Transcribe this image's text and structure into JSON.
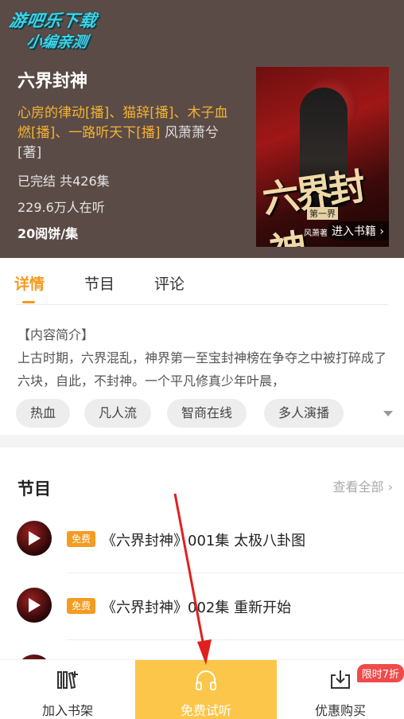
{
  "watermark": {
    "line1": "游吧乐下载",
    "line2": "小编亲测"
  },
  "book": {
    "title": "六界封神",
    "narrators": "心房的律动[播]、猫辞[播]、木子血燃[播]、一路听天下[播]",
    "author": "风萧萧兮[著]",
    "status": "已完结 共426集",
    "listeners": "229.6万人在听",
    "price": "20阅饼/集"
  },
  "cover": {
    "title_art": "六界封神",
    "volume": "第一界",
    "publisher": "风萧著",
    "enter_label": "进入书籍 ›"
  },
  "tabs": [
    {
      "label": "详情",
      "active": true
    },
    {
      "label": "节目",
      "active": false
    },
    {
      "label": "评论",
      "active": false
    }
  ],
  "intro": {
    "text": "【内容简介】\n上古时期，六界混乱，神界第一至宝封神榜在争夺之中被打碎成了六块，自此，不封神。一个平凡修真少年叶晨，"
  },
  "tags": [
    "热血",
    "凡人流",
    "智商在线",
    "多人演播"
  ],
  "episodes": {
    "heading": "节目",
    "view_all": "查看全部 ›",
    "items": [
      {
        "badge": "免费",
        "title": "《六界封神》001集 太极八卦图"
      },
      {
        "badge": "免费",
        "title": "《六界封神》002集 重新开始"
      }
    ]
  },
  "bottom_bar": {
    "shelf": "加入书架",
    "free_listen": "免费试听",
    "buy": "优惠购买",
    "limit_badge": "限时7折"
  },
  "colors": {
    "accent": "#f49b21",
    "header_bg": "#5b4b46",
    "free_button": "#fbc64a",
    "badge_red": "#ef4b4b",
    "arrow": "#e0201e"
  }
}
